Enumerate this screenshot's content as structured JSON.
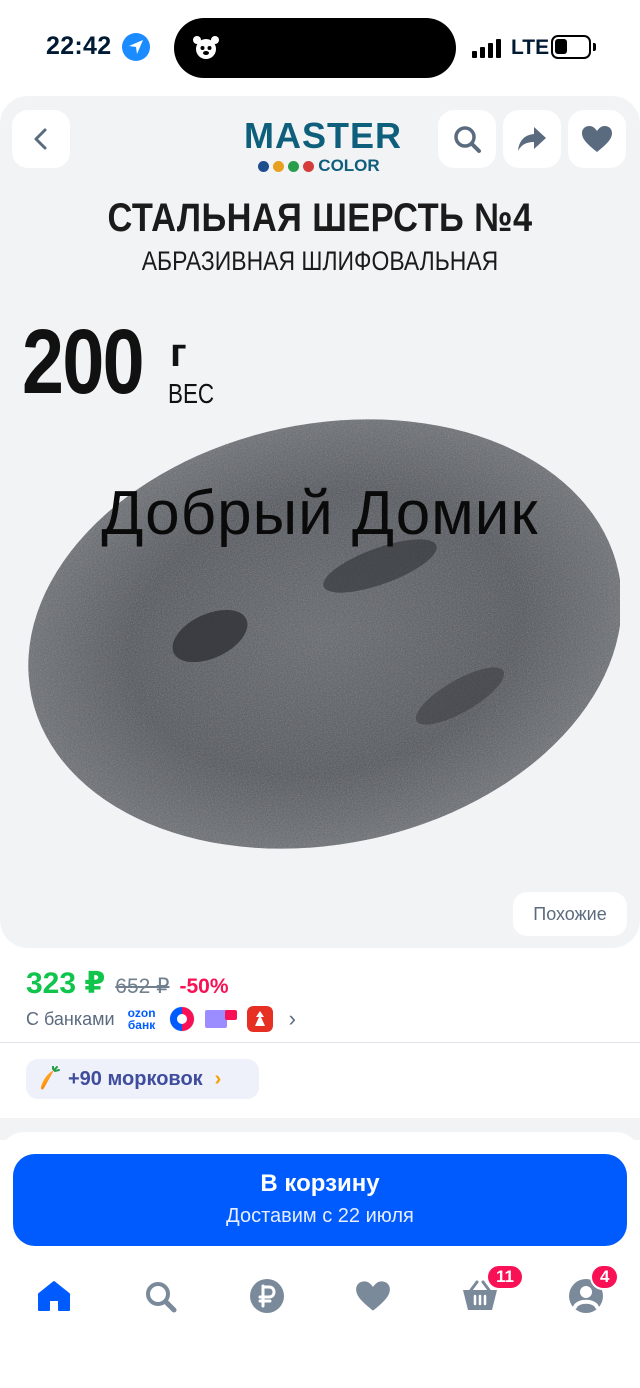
{
  "status_bar": {
    "time": "22:42",
    "network": "LTE",
    "icons": [
      "location-arrow-icon",
      "signal-bars-icon",
      "battery-icon"
    ]
  },
  "product_image": {
    "brand_top": "MASTER",
    "brand_bottom": "COLOR",
    "brand_dot_colors": [
      "#1f4e8c",
      "#e8a020",
      "#2a9d4a",
      "#d63c3c"
    ],
    "title_line1": "СТАЛЬНАЯ ШЕРСТЬ №4",
    "title_line2": "АБРАЗИВНАЯ ШЛИФОВАЛЬНАЯ",
    "weight_value": "200",
    "weight_unit": "г",
    "weight_label": "ВЕС",
    "watermark": "Добрый Домик",
    "similar_label": "Похожие"
  },
  "actions": {
    "back": "chevron-left-icon",
    "search": "search-icon",
    "share": "share-arrow-icon",
    "favorite": "heart-icon"
  },
  "price": {
    "current": "323 ₽",
    "old": "652 ₽",
    "discount": "-50%",
    "current_color": "#10c44c",
    "discount_color": "#f91155",
    "banks_label": "С банками",
    "ozon_bank_line1": "ozon",
    "ozon_bank_line2": "банк"
  },
  "bonus": {
    "label": "+90 морковок"
  },
  "cart": {
    "title": "В корзину",
    "subtitle": "Доставим с 22 июля",
    "accent_color": "#005bff"
  },
  "tabbar": {
    "items": [
      "home-icon",
      "search-icon",
      "ruble-icon",
      "heart-icon",
      "basket-icon",
      "profile-icon"
    ],
    "cart_badge": "11",
    "profile_badge": "4"
  }
}
